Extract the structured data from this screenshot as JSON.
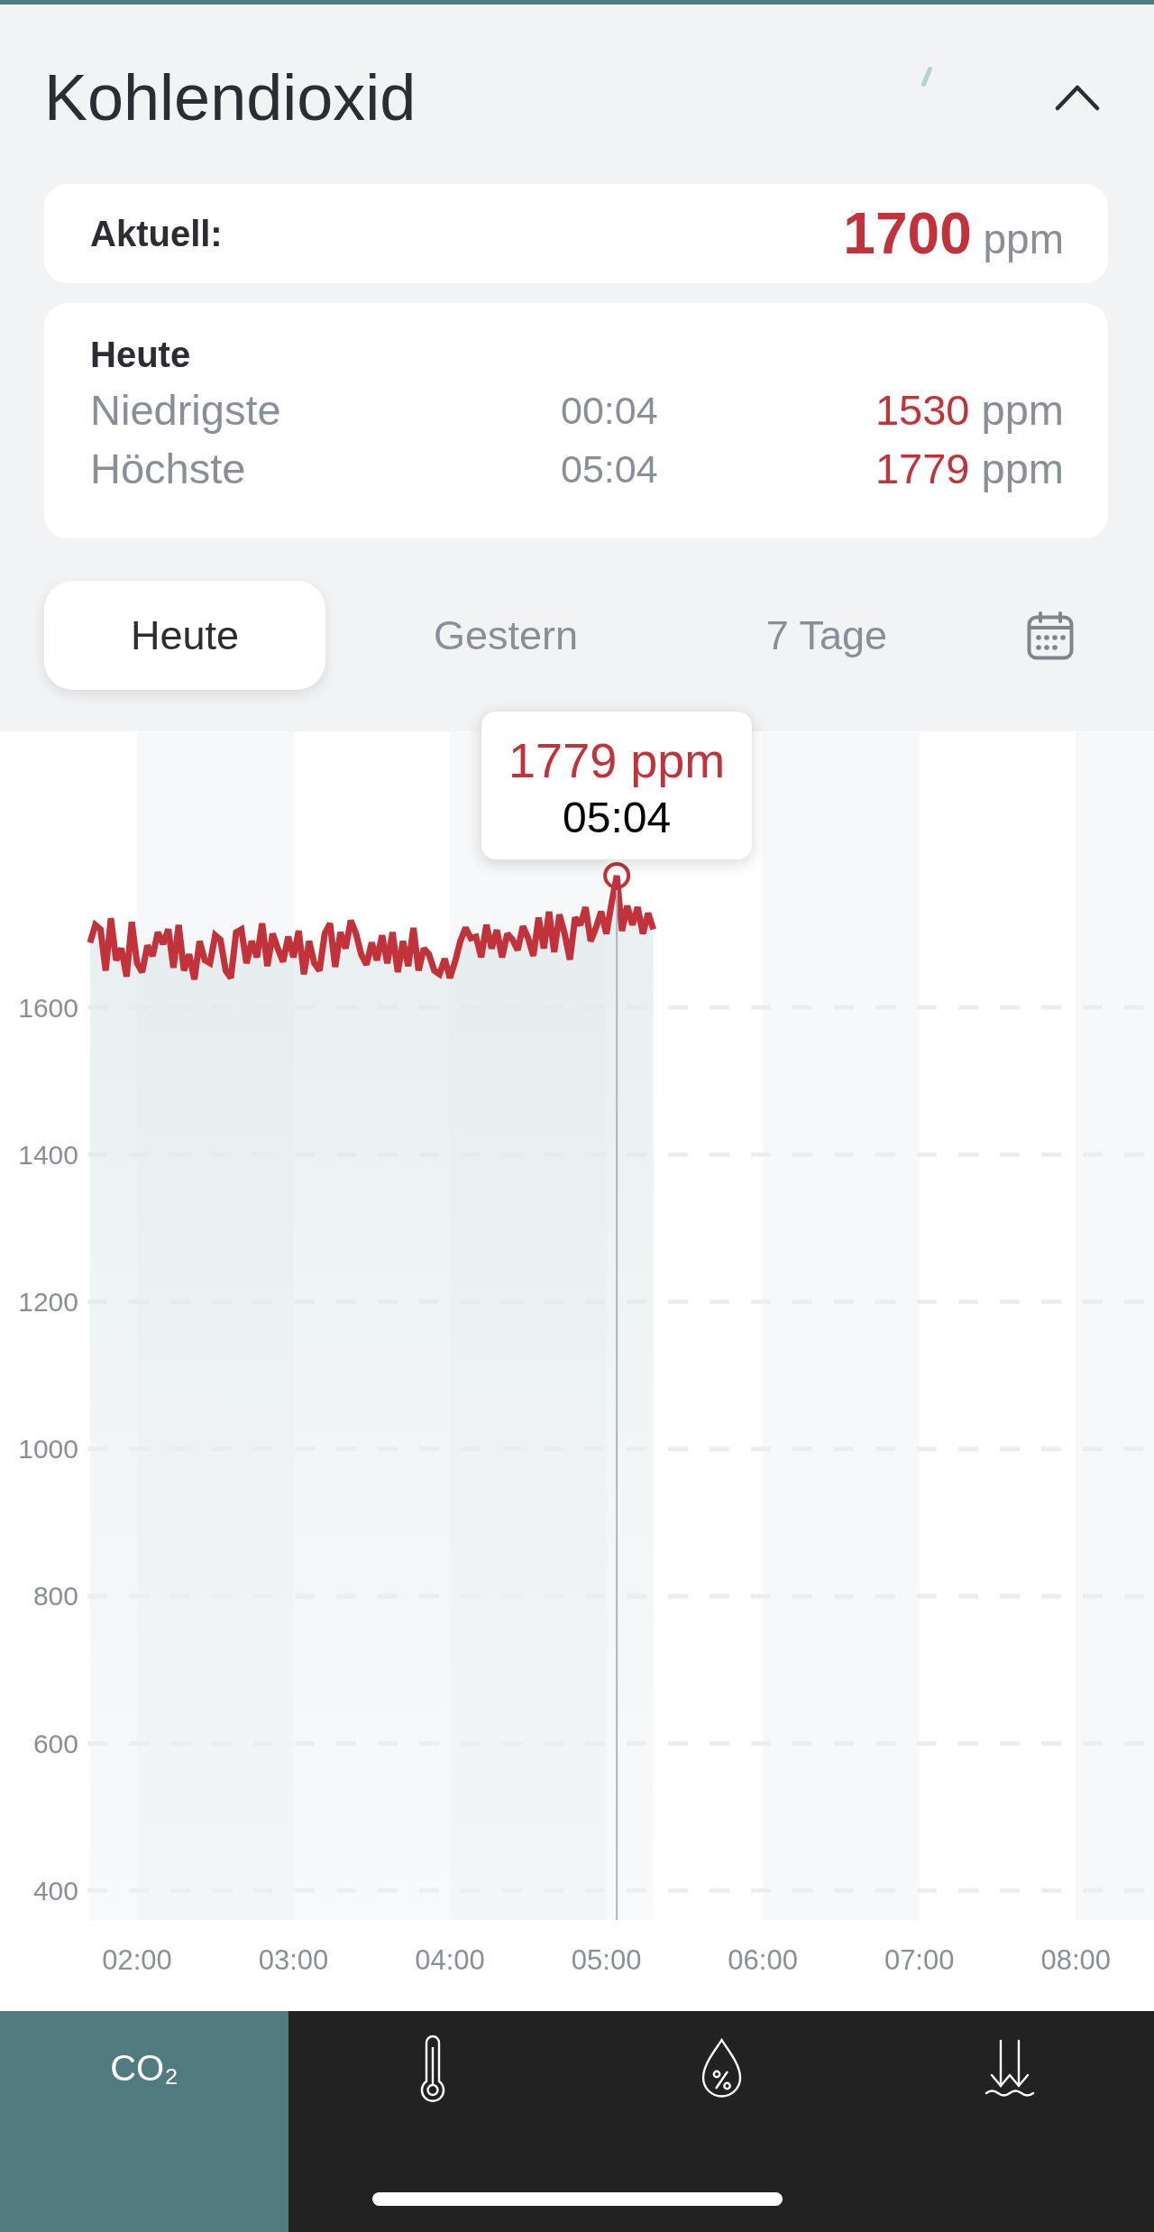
{
  "header": {
    "title": "Kohlendioxid",
    "expanded": true
  },
  "current": {
    "label": "Aktuell:",
    "value": "1700",
    "unit": "ppm"
  },
  "summary": {
    "title": "Heute",
    "rows": [
      {
        "label": "Niedrigste",
        "time": "00:04",
        "value": "1530",
        "unit": "ppm"
      },
      {
        "label": "Höchste",
        "time": "05:04",
        "value": "1779",
        "unit": "ppm"
      }
    ]
  },
  "tabs": [
    {
      "label": "Heute",
      "selected": true
    },
    {
      "label": "Gestern",
      "selected": false
    },
    {
      "label": "7 Tage",
      "selected": false
    }
  ],
  "chart": {
    "tooltip": {
      "value": "1779 ppm",
      "time": "05:04"
    },
    "chart_data": {
      "type": "area",
      "x": [
        102,
        104,
        106,
        108,
        110,
        112,
        114,
        116,
        118,
        120,
        122,
        124,
        126,
        128,
        130,
        132,
        134,
        136,
        138,
        140,
        142,
        144,
        146,
        148,
        150,
        152,
        154,
        156,
        158,
        160,
        162,
        164,
        166,
        168,
        170,
        172,
        174,
        176,
        178,
        180,
        182,
        184,
        186,
        188,
        190,
        192,
        194,
        196,
        198,
        200,
        202,
        204,
        206,
        208,
        210,
        212,
        214,
        216,
        218,
        220,
        222,
        224,
        226,
        228,
        230,
        232,
        234,
        236,
        238,
        240,
        242,
        244,
        246,
        248,
        250,
        252,
        254,
        256,
        258,
        260,
        262,
        264,
        266,
        268,
        270,
        272,
        274,
        276,
        278,
        280,
        282,
        284,
        286,
        288,
        290,
        292,
        294,
        296,
        298,
        300,
        302,
        304,
        306,
        308,
        310,
        312,
        314,
        316,
        318
      ],
      "series": [
        {
          "color": "#c1323a",
          "values": [
            1688,
            1712,
            1706,
            1650,
            1721,
            1664,
            1680,
            1642,
            1716,
            1660,
            1648,
            1684,
            1670,
            1702,
            1686,
            1706,
            1654,
            1712,
            1650,
            1672,
            1638,
            1690,
            1664,
            1660,
            1698,
            1692,
            1650,
            1640,
            1702,
            1706,
            1660,
            1690,
            1668,
            1714,
            1656,
            1700,
            1680,
            1662,
            1696,
            1668,
            1704,
            1645,
            1690,
            1660,
            1650,
            1700,
            1714,
            1655,
            1702,
            1680,
            1718,
            1700,
            1672,
            1658,
            1688,
            1664,
            1698,
            1660,
            1702,
            1648,
            1690,
            1656,
            1708,
            1650,
            1680,
            1672,
            1650,
            1645,
            1666,
            1640,
            1662,
            1690,
            1708,
            1694,
            1696,
            1668,
            1712,
            1680,
            1705,
            1668,
            1700,
            1692,
            1678,
            1710,
            1694,
            1670,
            1722,
            1680,
            1730,
            1675,
            1726,
            1700,
            1665,
            1722,
            1712,
            1736,
            1690,
            1708,
            1730,
            1700,
            1742,
            1779,
            1704,
            1738,
            1712,
            1736,
            1700,
            1728,
            1706
          ]
        }
      ],
      "xlim": [
        101,
        510
      ],
      "ylim": [
        360,
        1975
      ],
      "xticks": [
        {
          "value": 120,
          "label": "02:00"
        },
        {
          "value": 180,
          "label": "03:00"
        },
        {
          "value": 240,
          "label": "04:00"
        },
        {
          "value": 300,
          "label": "05:00"
        },
        {
          "value": 360,
          "label": "06:00"
        },
        {
          "value": 420,
          "label": "07:00"
        },
        {
          "value": 480,
          "label": "08:00"
        }
      ],
      "yticks": [
        400,
        600,
        800,
        1000,
        1200,
        1400,
        1600
      ],
      "grid": true,
      "ref_lines": [
        {
          "axis": "x",
          "value": 304
        }
      ]
    }
  },
  "bottom_nav": [
    {
      "kind": "text",
      "label": "CO₂",
      "selected": true
    },
    {
      "kind": "icon",
      "selected": false
    },
    {
      "kind": "icon",
      "selected": false
    },
    {
      "kind": "icon",
      "selected": false
    }
  ]
}
